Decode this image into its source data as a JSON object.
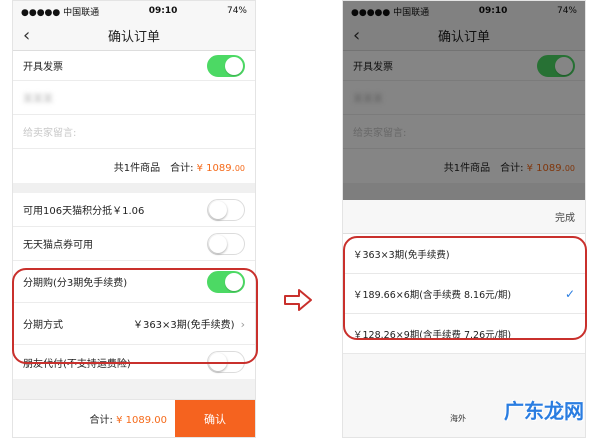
{
  "status_bar": {
    "carrier": "●●●●● 中国联通",
    "time": "09:10",
    "battery": "74%"
  },
  "nav": {
    "title": "确认订单"
  },
  "left": {
    "invoice_label": "开具发票",
    "blurred_text": "某某某",
    "seller_message_placeholder": "给卖家留言:",
    "items_count": "共1件商品",
    "subtotal_label": "合计:",
    "subtotal_amount": "¥ 1089.",
    "subtotal_cents": "00",
    "points_label": "可用106天猫积分抵￥1.06",
    "coupon_label": "无天猫点券可用",
    "installment_label": "分期购(分3期免手续费)",
    "installment_method_label": "分期方式",
    "installment_method_value": "￥363×3期(免手续费)",
    "friend_pay_label": "朋友代付(不支持运费险)",
    "bottom_total_label": "合计:",
    "bottom_total_amount": "¥ 1089.00",
    "confirm_button": "确认"
  },
  "toggles": {
    "invoice": true,
    "points": false,
    "coupon": false,
    "installment": true,
    "friend_pay": false
  },
  "right": {
    "done_label": "完成",
    "options": [
      {
        "label": "￥363×3期(免手续费)",
        "selected": false
      },
      {
        "label": "￥189.66×6期(含手续费 8.16元/期)",
        "selected": true
      },
      {
        "label": "￥128.26×9期(含手续费 7.26元/期)",
        "selected": false
      }
    ]
  },
  "watermark": {
    "text": "广东龙网",
    "small_text": "海外"
  },
  "colors": {
    "accent_orange": "#f5631f",
    "toggle_green": "#4cd964",
    "highlight_red": "#c9302c",
    "check_blue": "#2a7de1"
  },
  "icons": {
    "back": "chevron-left-icon",
    "transition_arrow": "right-arrow-icon",
    "selected": "checkmark-icon"
  }
}
